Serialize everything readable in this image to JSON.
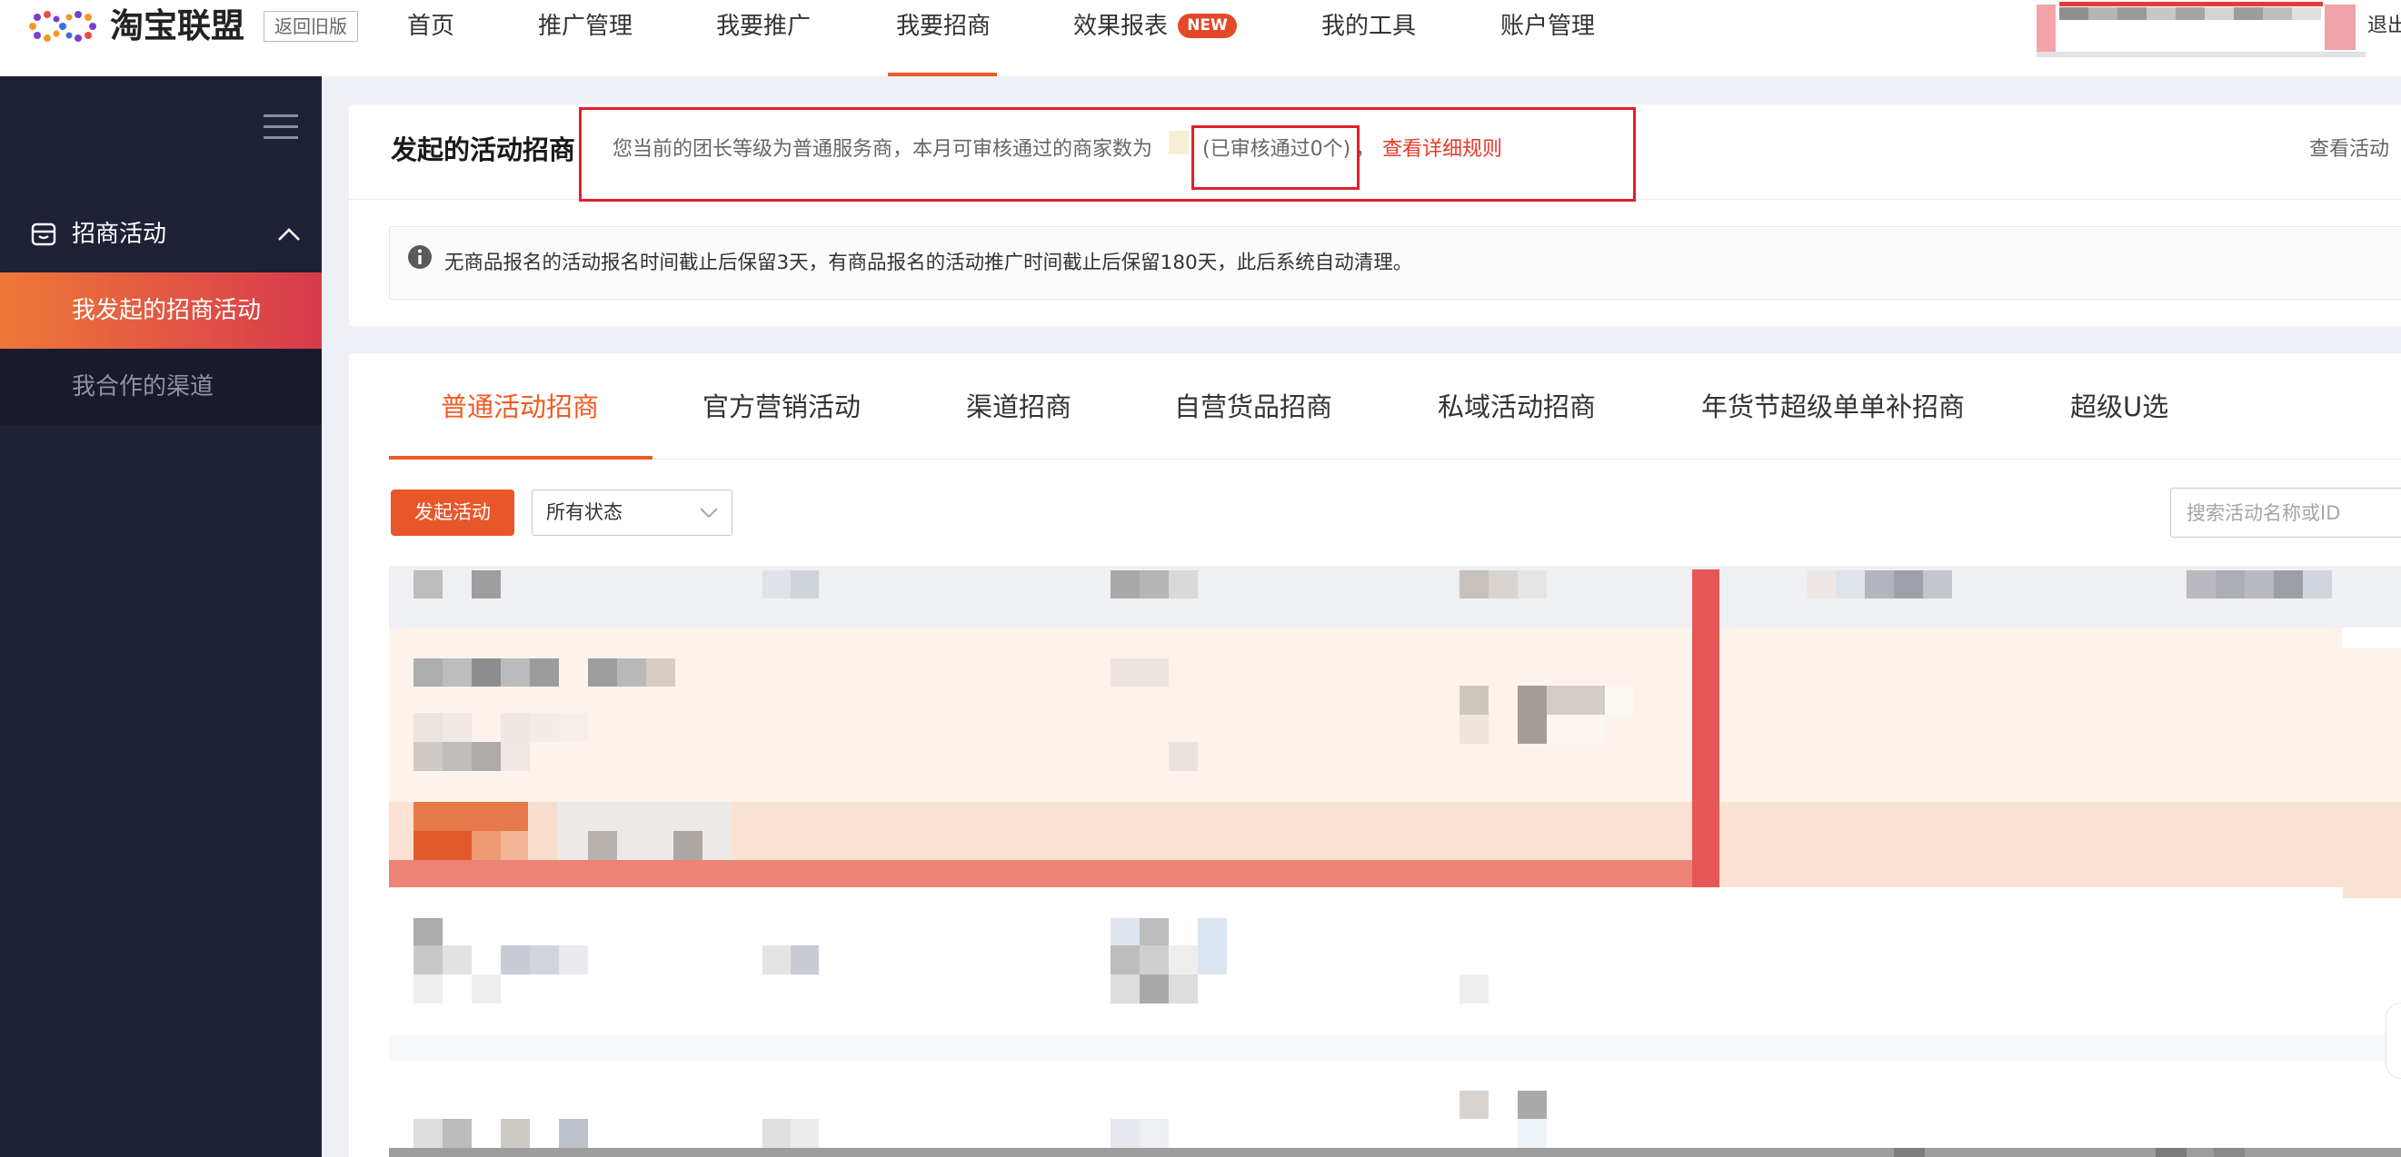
{
  "header": {
    "brand": "淘宝联盟",
    "back_to_old_version": "返回旧版",
    "nav": [
      {
        "label": "首页"
      },
      {
        "label": "推广管理"
      },
      {
        "label": "我要推广"
      },
      {
        "label": "我要招商",
        "active": true
      },
      {
        "label": "效果报表",
        "badge": "NEW"
      },
      {
        "label": "我的工具"
      },
      {
        "label": "账户管理"
      }
    ],
    "logout": "退出"
  },
  "sidebar": {
    "group": {
      "label": "招商活动",
      "expanded": true,
      "icon": "store-icon"
    },
    "items": [
      {
        "label": "我发起的招商活动",
        "active": true
      },
      {
        "label": "我合作的渠道"
      }
    ]
  },
  "notice": {
    "title": "发起的活动招商",
    "level_text": "您当前的团长等级为普通服务商，本月可审核通过的商家数为",
    "approved_text": "(已审核通过0个)",
    "separator": "，",
    "rules_link": "查看详细规则",
    "right_link": "查看活动",
    "info_text": "无商品报名的活动报名时间截止后保留3天，有商品报名的活动推广时间截止后保留180天，此后系统自动清理。"
  },
  "campaigns": {
    "tabs": [
      {
        "label": "普通活动招商",
        "active": true
      },
      {
        "label": "官方营销活动"
      },
      {
        "label": "渠道招商"
      },
      {
        "label": "自营货品招商"
      },
      {
        "label": "私域活动招商"
      },
      {
        "label": "年货节超级单单补招商"
      },
      {
        "label": "超级U选"
      }
    ],
    "create_button": "发起活动",
    "status_filter": {
      "selected": "所有状态"
    },
    "search": {
      "placeholder": "搜索活动名称或ID"
    }
  },
  "colors": {
    "accent": "#f05a23",
    "link": "#e8382a",
    "sidebar": "#1f2136",
    "annotation": "#e0202a"
  }
}
